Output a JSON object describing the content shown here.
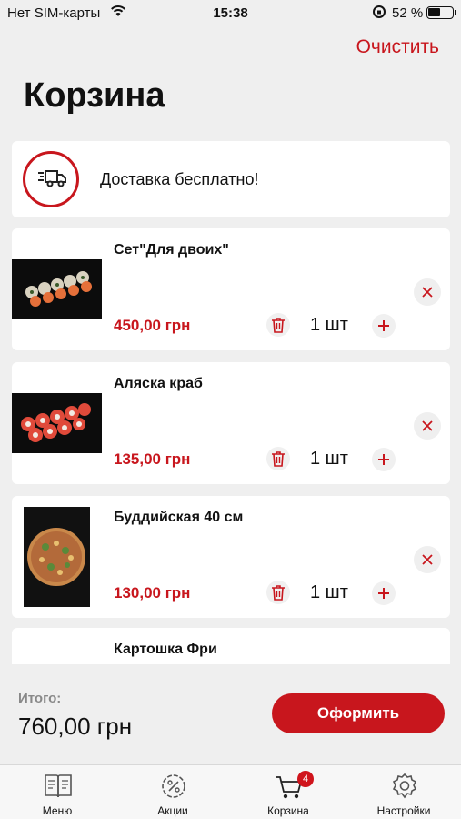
{
  "status_bar": {
    "carrier": "Нет SIM-карты",
    "time": "15:38",
    "battery": "52 %"
  },
  "header": {
    "clear_label": "Очистить",
    "title": "Корзина"
  },
  "delivery": {
    "text": "Доставка бесплатно!"
  },
  "cart": {
    "items": [
      {
        "name": "Сет\"Для двоих\"",
        "price": "450,00 грн",
        "quantity": "1 шт"
      },
      {
        "name": "Аляска краб",
        "price": "135,00 грн",
        "quantity": "1 шт"
      },
      {
        "name": "Буддийская 40 см",
        "price": "130,00 грн",
        "quantity": "1 шт"
      },
      {
        "name": "Картошка Фри"
      }
    ]
  },
  "summary": {
    "total_label": "Итого:",
    "total_value": "760,00 грн",
    "checkout_label": "Оформить"
  },
  "tab_bar": {
    "tabs": [
      {
        "label": "Меню",
        "icon": "menu-book-icon"
      },
      {
        "label": "Акции",
        "icon": "percent-badge-icon"
      },
      {
        "label": "Корзина",
        "icon": "cart-icon",
        "badge": "4"
      },
      {
        "label": "Настройки",
        "icon": "gear-icon"
      }
    ]
  },
  "colors": {
    "accent": "#c8161d",
    "background": "#efefef",
    "card": "#ffffff"
  }
}
